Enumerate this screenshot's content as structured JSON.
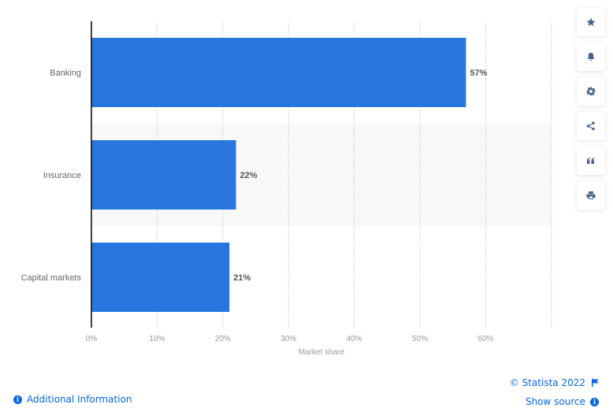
{
  "chart_data": {
    "type": "bar",
    "orientation": "horizontal",
    "title": "",
    "categories": [
      "Banking",
      "Insurance",
      "Capital markets"
    ],
    "values": [
      57,
      22,
      21
    ],
    "data_labels": [
      "57%",
      "22%",
      "21%"
    ],
    "xlabel": "Market share",
    "ylabel": "",
    "xlim": [
      0,
      70
    ],
    "x_ticks": [
      0,
      10,
      20,
      30,
      40,
      50,
      60
    ],
    "x_tick_labels": [
      "0%",
      "10%",
      "20%",
      "30%",
      "40%",
      "50%",
      "60%"
    ],
    "grid": true,
    "bar_color": "#2876dd",
    "legend": "none"
  },
  "toolbar": {
    "items": [
      {
        "name": "favorite",
        "icon": "star-icon"
      },
      {
        "name": "notification",
        "icon": "bell-icon"
      },
      {
        "name": "settings",
        "icon": "gear-icon"
      },
      {
        "name": "share",
        "icon": "share-icon"
      },
      {
        "name": "cite",
        "icon": "quote-icon"
      },
      {
        "name": "print",
        "icon": "print-icon"
      }
    ]
  },
  "footer": {
    "additional_info": "Additional Information",
    "copyright": "© Statista 2022",
    "show_source": "Show source",
    "link_color": "#0666e5"
  }
}
